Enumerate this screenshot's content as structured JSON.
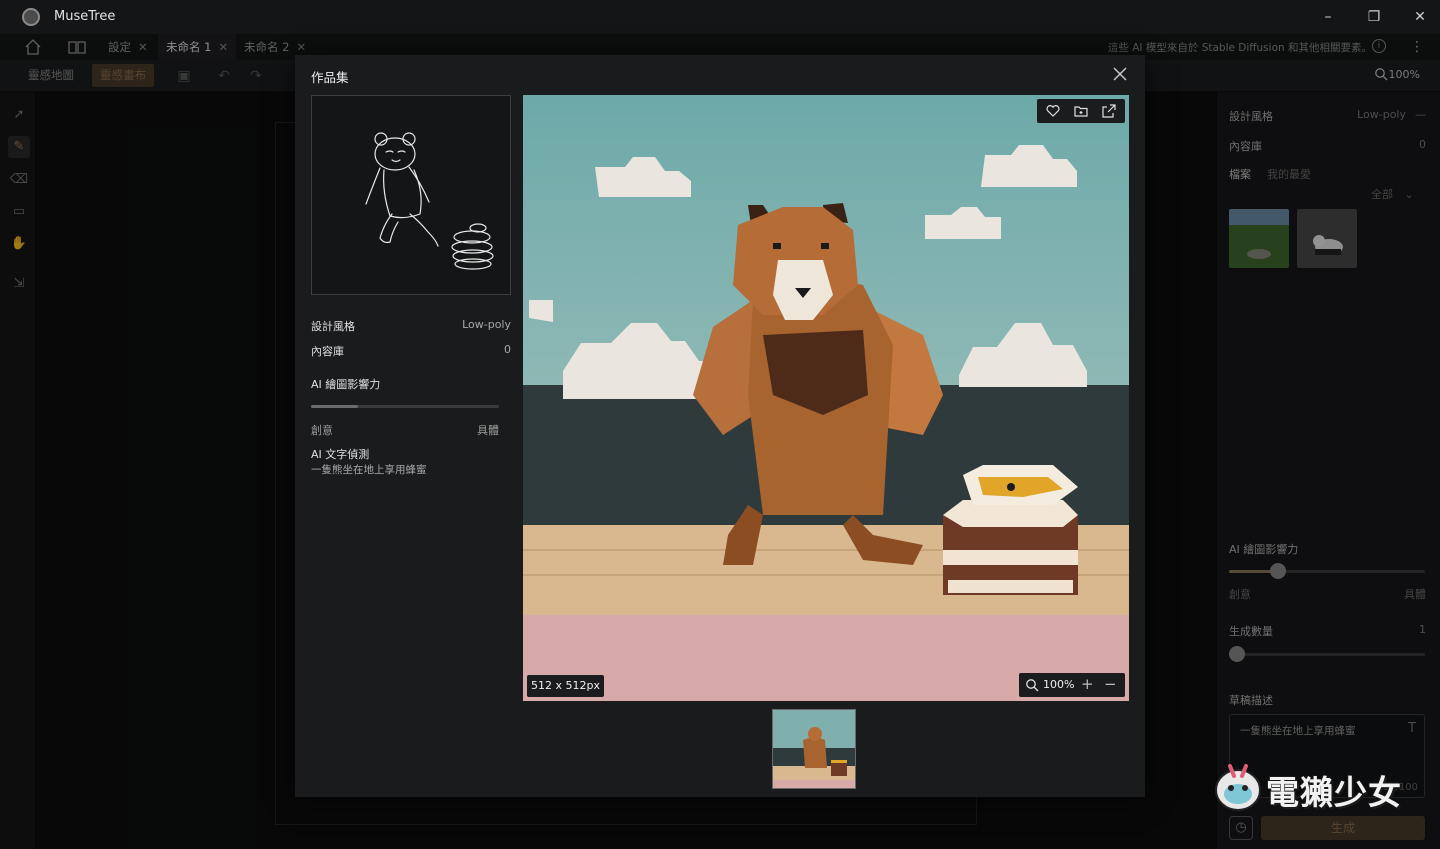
{
  "window": {
    "app_title": "MuseTree",
    "minimize": "–",
    "maximize": "❐",
    "close": "✕"
  },
  "tabs": {
    "items": [
      {
        "label": "設定",
        "close": "✕"
      },
      {
        "label": "未命名 1",
        "close": "✕",
        "active": true
      },
      {
        "label": "未命名 2",
        "close": "✕"
      }
    ],
    "notice": "這些 AI 模型來自於 Stable Diffusion 和其他相關要素。",
    "info": "i",
    "more": "⋮"
  },
  "toolbar": {
    "mode_map": "靈感地圖",
    "mode_canvas": "靈感畫布",
    "zoom": "100%"
  },
  "right_panel": {
    "style_label": "設計風格",
    "style_value": "Low-poly",
    "style_dash": "—",
    "library_label": "內容庫",
    "library_value": "0",
    "tab_files": "檔案",
    "tab_favorites": "我的最愛",
    "filter": "全部",
    "influence_label": "AI 繪圖影響力",
    "influence_value": 0.25,
    "influence_left": "創意",
    "influence_right": "具體",
    "count_label": "生成數量",
    "count_value": "1",
    "desc_label": "草稿描述",
    "desc_text": "一隻熊坐在地上享用蜂蜜",
    "desc_count": "11/100",
    "generate": "生成"
  },
  "modal": {
    "title": "作品集",
    "style_label": "設計風格",
    "style_value": "Low-poly",
    "library_label": "內容庫",
    "library_value": "0",
    "influence_label": "AI 繪圖影響力",
    "influence_value": 0.25,
    "influence_left": "創意",
    "influence_right": "具體",
    "text_detect_label": "AI 文字偵測",
    "text_detect_value": "一隻熊坐在地上享用蜂蜜",
    "image_size": "512 x 512px",
    "zoom": "100%"
  },
  "watermark": {
    "text": "電獺少女"
  },
  "colors": {
    "accent": "#4a3b2a",
    "accent_text": "#8a7150",
    "background": "#0d0e0f"
  }
}
